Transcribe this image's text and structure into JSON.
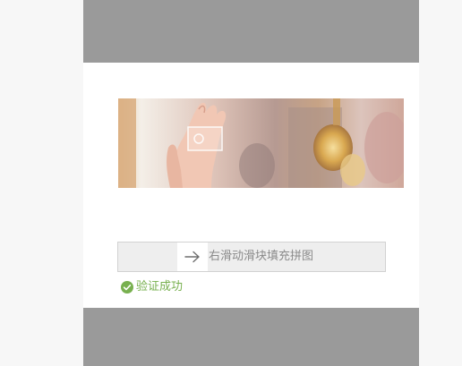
{
  "captcha": {
    "image": {
      "description_icon": "puzzle-image-icon"
    },
    "slider": {
      "hint": "右滑动滑块填充拼图",
      "handle_icon": "arrow-right-icon"
    },
    "status": {
      "icon": "check-circle-icon",
      "text": "验证成功",
      "color": "#78b04f"
    }
  },
  "colors": {
    "overlay": "#9a9a9a",
    "dialog": "#ffffff",
    "track": "#eeeeee",
    "success": "#78b04f"
  }
}
